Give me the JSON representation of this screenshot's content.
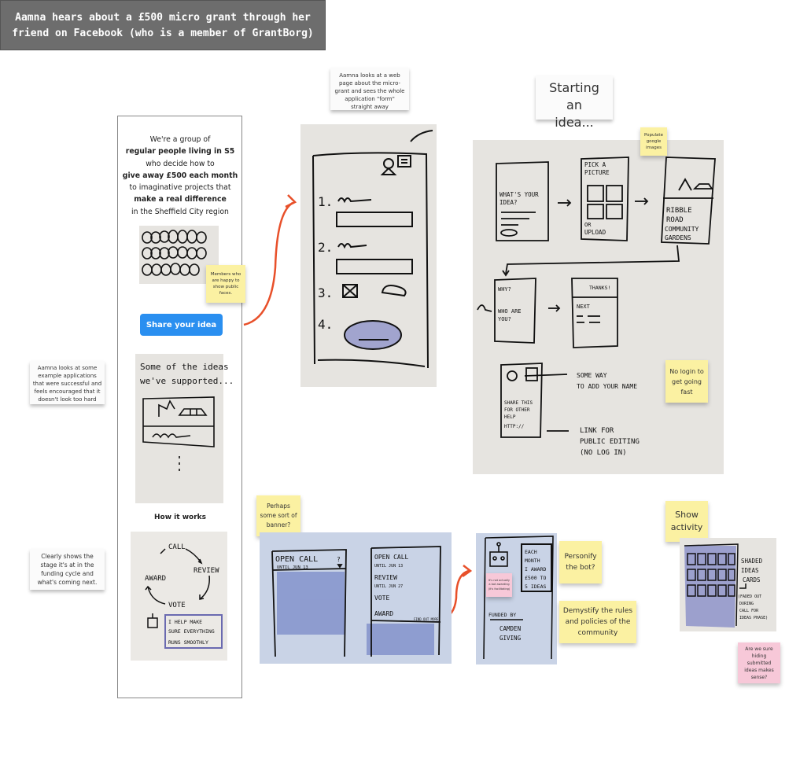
{
  "title": "Aamna hears about a £500 micro grant through her friend on Facebook (who is a member of GrantBorg)",
  "annotations": {
    "webpage_note": "Aamna looks at a web page about the micro-grant and sees the whole application \"form\" straight away",
    "starting_idea": "Starting an idea...",
    "examples_note": "Aamna looks at some example applications that were successful and feels encouraged that it doesn't look too hard",
    "stage_note": "Clearly shows the stage it's at in the funding cycle and what's coming next."
  },
  "landing_page": {
    "intro_lines": [
      {
        "text": "We're a group of",
        "bold": false
      },
      {
        "text": "regular people living in S5",
        "bold": true
      },
      {
        "text": "who decide how to",
        "bold": false
      },
      {
        "text": "give away £500 each month",
        "bold": true
      },
      {
        "text": "to imaginative projects that",
        "bold": false
      },
      {
        "text": "make a real difference",
        "bold": true
      },
      {
        "text": "in the Sheffield City region",
        "bold": false
      }
    ],
    "share_button": "Share your idea",
    "ideas_sketch": {
      "line1": "Some of the ideas",
      "line2": "we've supported..."
    },
    "how_it_works": "How it works",
    "cycle_sketch": {
      "call": "CALL",
      "review": "REVIEW",
      "vote": "VOTE",
      "award": "AWARD",
      "bot_speech": [
        "I HELP MAKE",
        "SURE EVERYTHING",
        "RUNS SMOOTHLY"
      ]
    }
  },
  "stickies": {
    "faces": "Members who are happy to show public faces.",
    "google_images": "Populate google images",
    "no_login": "No login to get going fast",
    "banner": "Perhaps some sort of banner?",
    "personify": "Personify the bot?",
    "demystify": "Demystify the rules and policies of the community",
    "not_bot": "It's not actually a bot awarding (it's facilitating)",
    "show_activity": "Show activity",
    "hiding": "Are we sure hiding submitted ideas makes sense?"
  },
  "form_sketch": {
    "steps": [
      "1.",
      "2.",
      "3.",
      "4."
    ]
  },
  "flow_sketch": {
    "screen1": [
      "WHAT'S YOUR",
      "IDEA?"
    ],
    "screen2": [
      "PICK A",
      "PICTURE",
      "OR",
      "UPLOAD"
    ],
    "screen3": [
      "RIBBLE",
      "ROAD",
      "COMMUNITY",
      "GARDENS"
    ],
    "screen4": [
      "WHY?",
      "WHO ARE",
      "YOU?"
    ],
    "screen5": [
      "THANKS!",
      "NEXT"
    ],
    "screen6": [
      "SHARE THIS",
      "FOR OTHER",
      "HELP",
      "HTTP://"
    ],
    "label_name": [
      "SOME WAY",
      "TO ADD YOUR NAME"
    ],
    "label_link": [
      "LINK FOR",
      "PUBLIC EDITING",
      "(NO LOG IN)"
    ]
  },
  "banner_sketch": {
    "left": {
      "title": "OPEN CALL",
      "sub": "UNTIL JUN 13",
      "help": "?"
    },
    "right": {
      "items": [
        "OPEN CALL",
        "UNTIL JUN 13",
        "REVIEW",
        "UNTIL JUN 27",
        "VOTE",
        "AWARD"
      ],
      "more": "FIND OUT MORE"
    }
  },
  "bot_sketch": {
    "speech": [
      "EACH",
      "MONTH",
      "I AWARD",
      "£500 TO",
      "5 IDEAS"
    ],
    "funded_by": "FUNDED BY",
    "funder": [
      "CAMDEN",
      "GIVING"
    ]
  },
  "activity_sketch": {
    "labels": [
      "SHADED",
      "IDEAS",
      "CARDS"
    ],
    "note": [
      "(FADED OUT",
      "DURING",
      "CALL FOR",
      "IDEAS PHASE)"
    ]
  },
  "colors": {
    "arrow": "#e8502a",
    "button": "#2a8ff0",
    "sticky_yellow": "#fbf1a2",
    "sticky_pink": "#f7c8d8",
    "highlighter": "#8a8fc8"
  }
}
